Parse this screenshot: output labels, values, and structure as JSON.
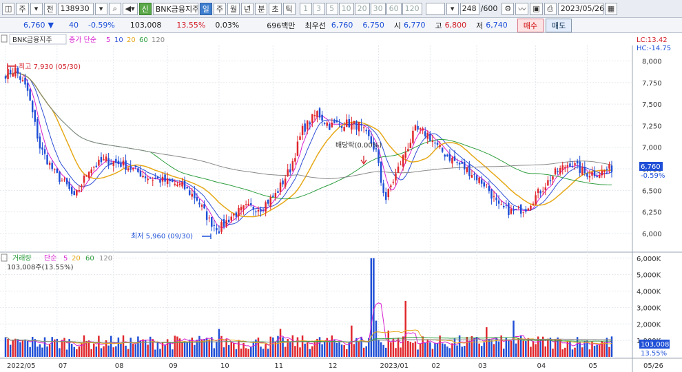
{
  "toolbar": {
    "period_label": "주",
    "prev_label": "전",
    "code": "138930",
    "sin_badge": "신",
    "stock_name": "BNK금융지주",
    "periods": [
      {
        "label": "일",
        "active": true
      },
      {
        "label": "주",
        "active": false
      },
      {
        "label": "월",
        "active": false
      },
      {
        "label": "년",
        "active": false
      },
      {
        "label": "분",
        "active": false
      },
      {
        "label": "초",
        "active": false
      },
      {
        "label": "틱",
        "active": false
      }
    ],
    "intervals": [
      "1",
      "3",
      "5",
      "10",
      "20",
      "30",
      "60",
      "120"
    ],
    "count": "248",
    "count_total": "/600",
    "date": "2023/05/26"
  },
  "quote": {
    "price": "6,760",
    "arrow": "▼",
    "change": "40",
    "change_pct": "-0.59%",
    "volume": "103,008",
    "volume_pct": "13.55%",
    "turnover": "0.03%",
    "amount": "696백만",
    "best_label": "최우선",
    "ask": "6,760",
    "bid": "6,750",
    "open_label": "시",
    "open": "6,770",
    "high_label": "고",
    "high": "6,800",
    "low_label": "저",
    "low": "6,740",
    "buy_label": "매수",
    "sell_label": "매도"
  },
  "price_panel": {
    "stock_label": "BNK금융지주",
    "ma_label": "종가 단순",
    "ma_periods": [
      "5",
      "10",
      "20",
      "60",
      "120"
    ],
    "lc": "LC:13.42",
    "hc": "HC:-14.75",
    "high_annot": "최고 7,930 (05/30)",
    "low_annot": "최저 5,960 (09/30)",
    "dividend_annot": "배당락(0.00%)",
    "last_price_tag": "6,760",
    "last_pct_tag": "-0.59%"
  },
  "volume_panel": {
    "label": "거래량",
    "ma_label": "단순",
    "ma_periods": [
      "5",
      "20",
      "60",
      "120"
    ],
    "value_label": "103,008주(13.55%)",
    "last_tag": "103,008",
    "last_pct_tag": "13.55%"
  },
  "colors": {
    "up": "#e0262c",
    "down": "#1f4fd6",
    "ma5": "#d81fd0",
    "ma10": "#2f4fd6",
    "ma20": "#e6a817",
    "ma60": "#2e9e3e",
    "ma120": "#888888"
  },
  "chart_data": {
    "type": "candlestick",
    "price_axis": {
      "min": 5800,
      "max": 8100,
      "ticks": [
        "8,000",
        "7,750",
        "7,500",
        "7,250",
        "7,000",
        "6,750",
        "6,500",
        "6,250",
        "6,000"
      ],
      "tick_values": [
        8000,
        7750,
        7500,
        7250,
        7000,
        6750,
        6500,
        6250,
        6000
      ]
    },
    "volume_axis": {
      "max": 6200000,
      "ticks": [
        "6,000K",
        "5,000K",
        "4,000K",
        "3,000K",
        "2,000K",
        "1,000K"
      ],
      "tick_values": [
        6000000,
        5000000,
        4000000,
        3000000,
        2000000,
        1000000
      ]
    },
    "x_ticks": [
      "2022/05",
      "07",
      "08",
      "09",
      "10",
      "11",
      "12",
      "2023/01",
      "02",
      "03",
      "04",
      "05",
      "05/26"
    ],
    "x_tick_index": [
      0,
      21,
      44,
      66,
      87,
      109,
      131,
      152,
      173,
      192,
      216,
      237,
      247
    ],
    "close_anchors": [
      [
        0,
        7850
      ],
      [
        4,
        7900
      ],
      [
        9,
        7650
      ],
      [
        14,
        7000
      ],
      [
        20,
        6700
      ],
      [
        25,
        6550
      ],
      [
        28,
        6400
      ],
      [
        34,
        6750
      ],
      [
        41,
        6850
      ],
      [
        48,
        6800
      ],
      [
        58,
        6650
      ],
      [
        66,
        6600
      ],
      [
        72,
        6550
      ],
      [
        78,
        6400
      ],
      [
        83,
        6150
      ],
      [
        87,
        6050
      ],
      [
        92,
        6200
      ],
      [
        98,
        6300
      ],
      [
        104,
        6300
      ],
      [
        110,
        6450
      ],
      [
        116,
        6750
      ],
      [
        121,
        7200
      ],
      [
        127,
        7400
      ],
      [
        132,
        7250
      ],
      [
        138,
        7280
      ],
      [
        144,
        7250
      ],
      [
        148,
        7100
      ],
      [
        151,
        6950
      ],
      [
        153,
        6600
      ],
      [
        155,
        6400
      ],
      [
        157,
        6550
      ],
      [
        160,
        6750
      ],
      [
        163,
        6950
      ],
      [
        167,
        7200
      ],
      [
        172,
        7150
      ],
      [
        176,
        7000
      ],
      [
        180,
        6900
      ],
      [
        185,
        6800
      ],
      [
        190,
        6700
      ],
      [
        196,
        6550
      ],
      [
        201,
        6300
      ],
      [
        207,
        6250
      ],
      [
        212,
        6300
      ],
      [
        218,
        6500
      ],
      [
        224,
        6700
      ],
      [
        230,
        6820
      ],
      [
        236,
        6700
      ],
      [
        242,
        6700
      ],
      [
        247,
        6760
      ]
    ],
    "volume_base": 1100000,
    "volume_spikes": [
      [
        149,
        6000000
      ],
      [
        150,
        6000000
      ],
      [
        163,
        3400000
      ],
      [
        151,
        2200000
      ],
      [
        87,
        1700000
      ],
      [
        112,
        1700000
      ],
      [
        141,
        1900000
      ],
      [
        196,
        1800000
      ],
      [
        207,
        2200000
      ],
      [
        156,
        1600000
      ]
    ]
  }
}
